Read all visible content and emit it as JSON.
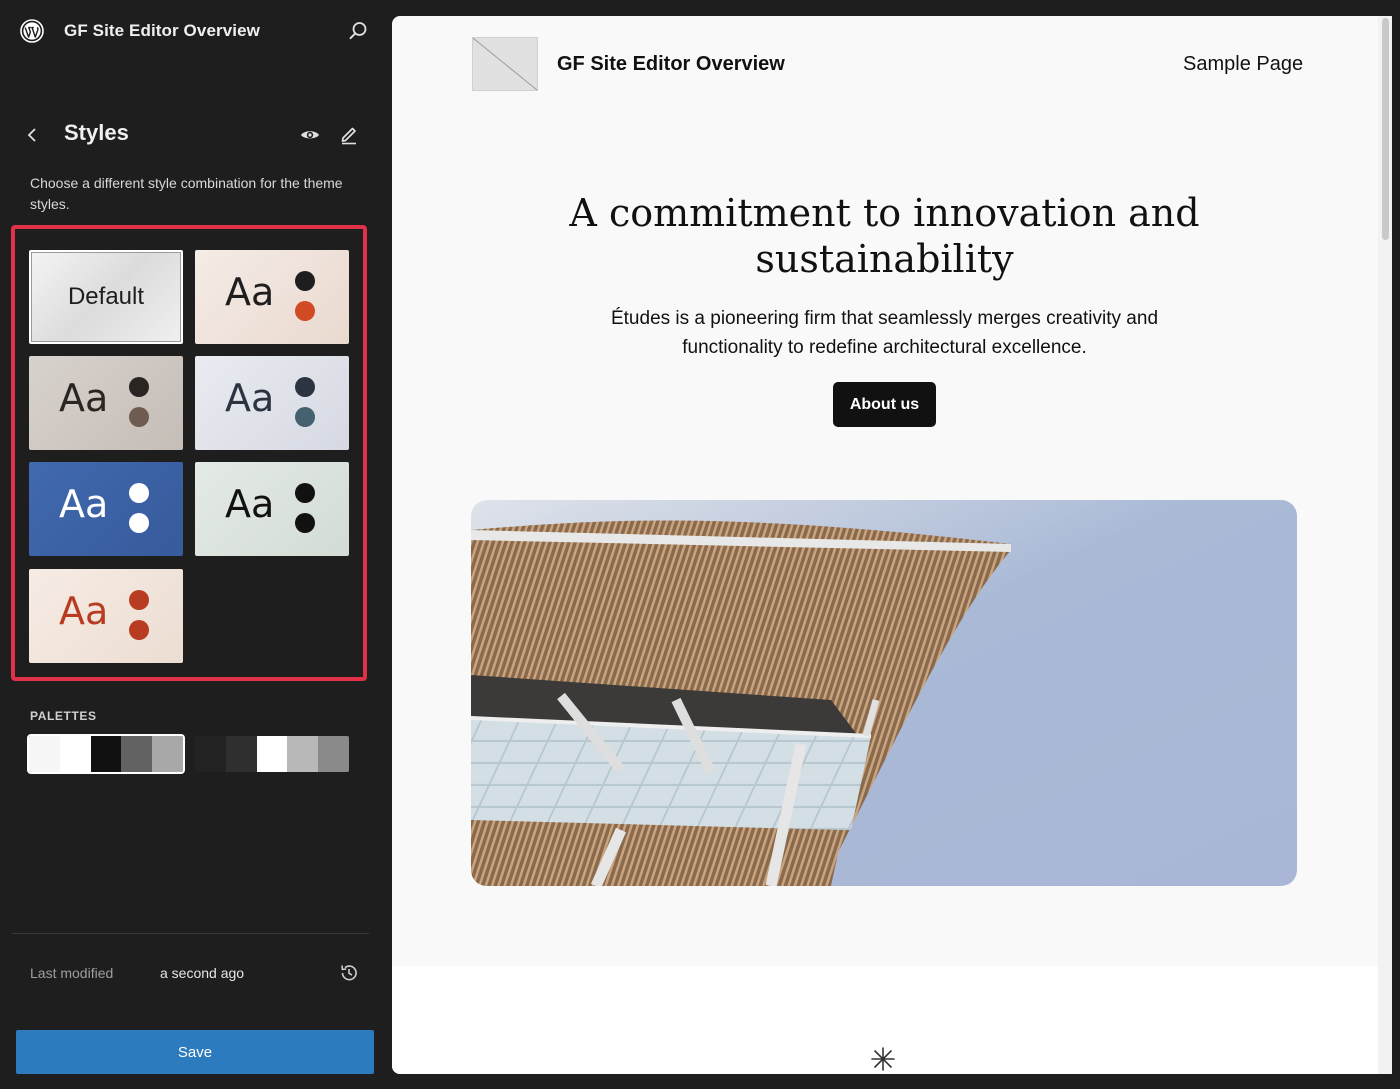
{
  "sidebar": {
    "site_title": "GF Site Editor Overview",
    "panel_title": "Styles",
    "description": "Choose a different style combination for the theme styles.",
    "variations": [
      {
        "label": "Default",
        "bg": "#e8e8e8",
        "fg": "#1e1e1e",
        "dot1": null,
        "dot2": null,
        "selected": true
      },
      {
        "label": "Aa",
        "bg": "#f0e6e0",
        "fg": "#1e1e1e",
        "dot1": "#1e1e1e",
        "dot2": "#d04a24",
        "selected": false
      },
      {
        "label": "Aa",
        "bg": "#d2ccc7",
        "fg": "#2a2522",
        "dot1": "#2a2522",
        "dot2": "#6e5c50",
        "selected": false
      },
      {
        "label": "Aa",
        "bg": "#e2e4ec",
        "fg": "#2b3440",
        "dot1": "#2b3440",
        "dot2": "#45606e",
        "selected": false
      },
      {
        "label": "Aa",
        "bg": "#3d63a8",
        "fg": "#ffffff",
        "dot1": "#ffffff",
        "dot2": "#ffffff",
        "selected": false
      },
      {
        "label": "Aa",
        "bg": "#dde4df",
        "fg": "#111111",
        "dot1": "#111111",
        "dot2": "#111111",
        "selected": false
      },
      {
        "label": "Aa",
        "bg": "#f3e7de",
        "fg": "#b73c22",
        "dot1": "#b73c22",
        "dot2": "#b73c22",
        "selected": false
      }
    ],
    "palettes_label": "PALETTES",
    "palettes": [
      {
        "colors": [
          "#f7f7f7",
          "#ffffff",
          "#111111",
          "#626262",
          "#a8a8a8"
        ],
        "selected": true
      },
      {
        "colors": [
          "#222222",
          "#2f2f2f",
          "#ffffff",
          "#b8b8b8",
          "#8a8a8a"
        ],
        "selected": false
      }
    ],
    "last_modified_label": "Last modified",
    "last_modified_value": "a second ago",
    "save_label": "Save"
  },
  "preview": {
    "site_title": "GF Site Editor Overview",
    "nav_link": "Sample Page",
    "hero_title": "A commitment to innovation and sustainability",
    "hero_text": "Études is a pioneering firm that seamlessly merges creativity and functionality to redefine architectural excellence.",
    "button_label": "About us"
  },
  "colors": {
    "sidebar_bg": "#1e1e1e",
    "highlight_border": "#e03148",
    "save_button": "#2c7bbf",
    "canvas_bg": "#f9f9f9"
  },
  "icons": [
    "wordpress-logo-icon",
    "search-icon",
    "back-chevron-icon",
    "eye-icon",
    "pencil-icon",
    "history-icon",
    "asterisk-icon"
  ]
}
